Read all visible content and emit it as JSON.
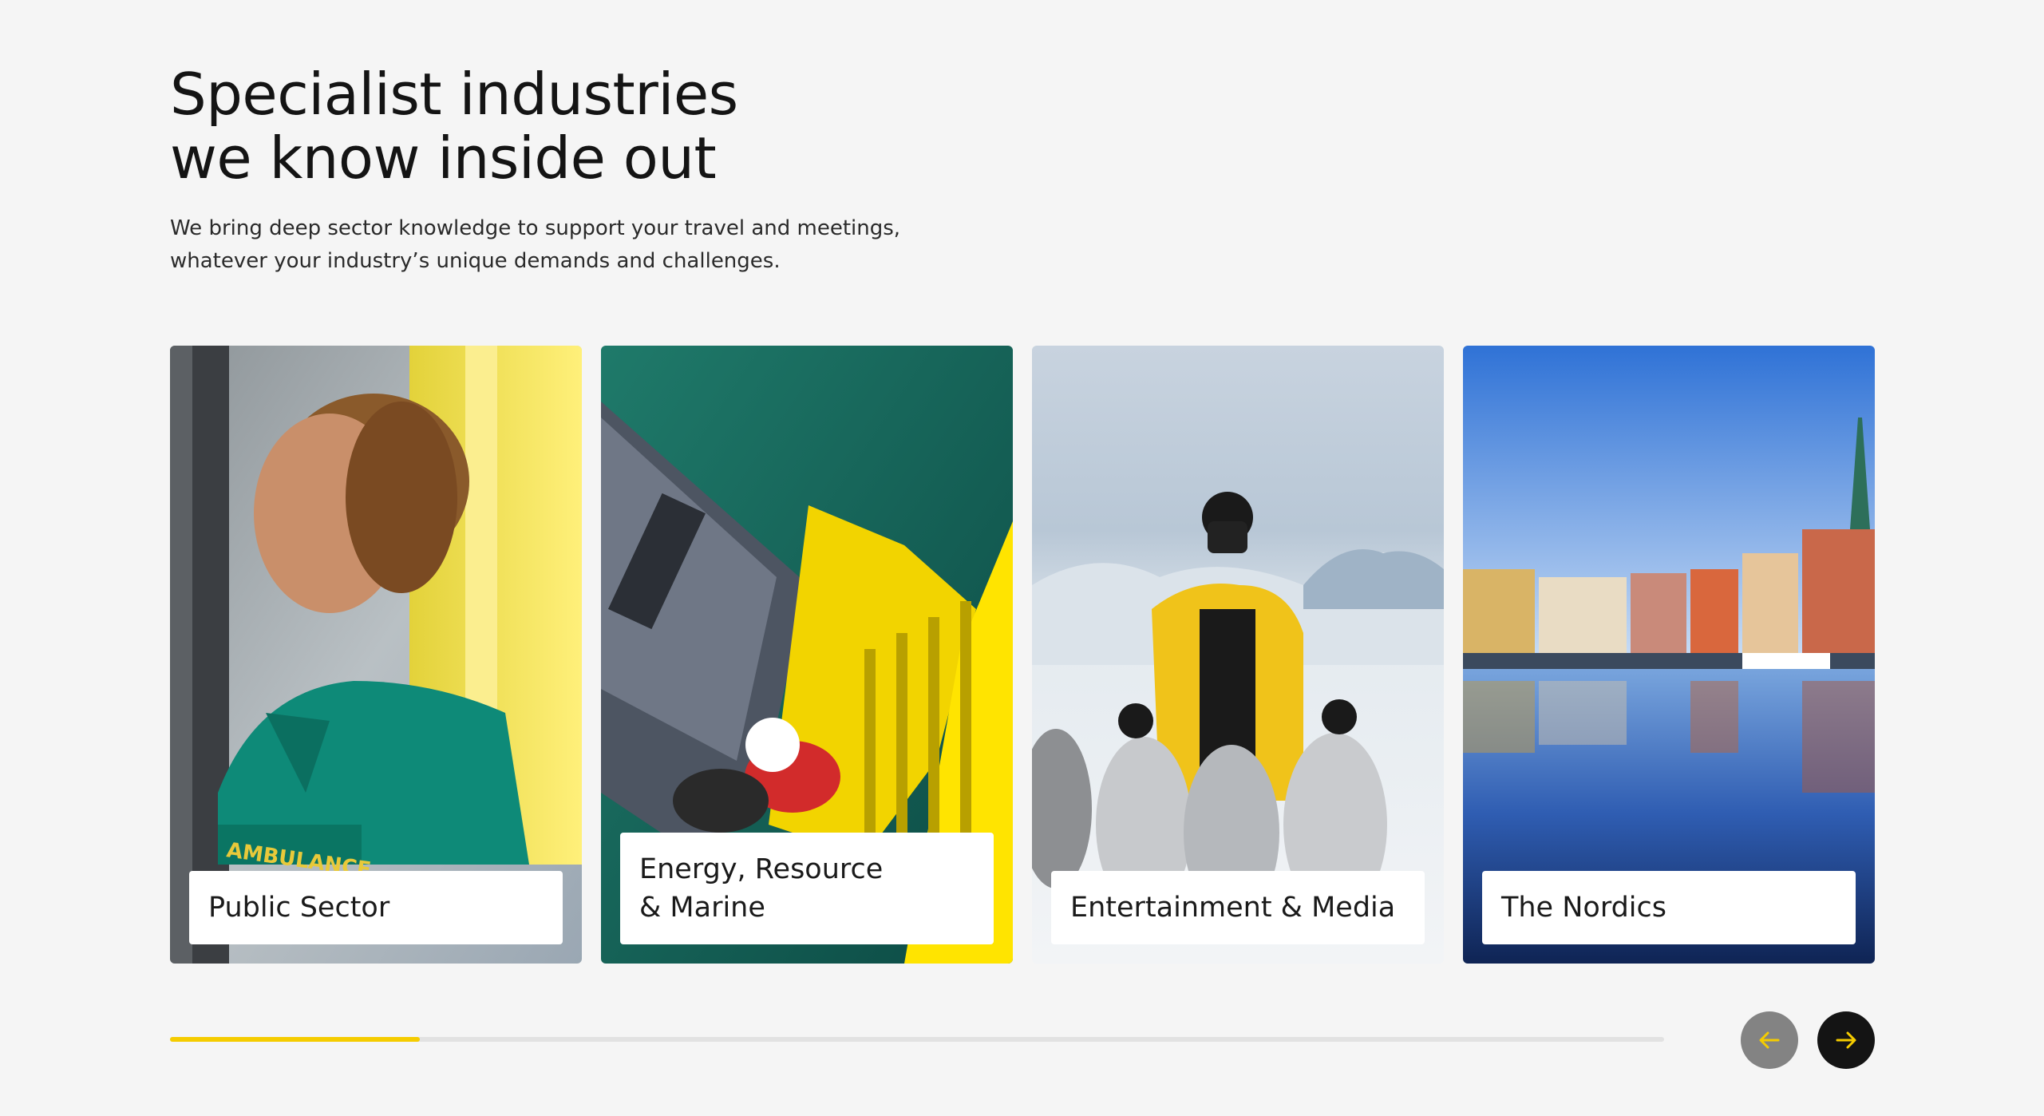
{
  "section": {
    "heading_line1": "Specialist industries",
    "heading_line2": "we know inside out",
    "intro_line1": "We bring deep sector knowledge to support your travel and meetings,",
    "intro_line2": "whatever your industry’s unique demands and challenges."
  },
  "cards": [
    {
      "label": "Public Sector",
      "image": "paramedic-in-ambulance"
    },
    {
      "label": "Energy, Resource\n& Marine",
      "image": "offshore-worker-on-yellow-ladder"
    },
    {
      "label": "Entertainment & Media",
      "image": "photographer-with-penguins"
    },
    {
      "label": "The Nordics",
      "image": "stockholm-harbour"
    }
  ],
  "carousel": {
    "progress_fraction": 0.167,
    "prev_label": "Previous",
    "next_label": "Next",
    "prev_icon": "arrow-left-icon",
    "next_icon": "arrow-right-icon"
  },
  "colors": {
    "accent": "#f5cc00",
    "background": "#f5f5f5",
    "text": "#141414"
  }
}
